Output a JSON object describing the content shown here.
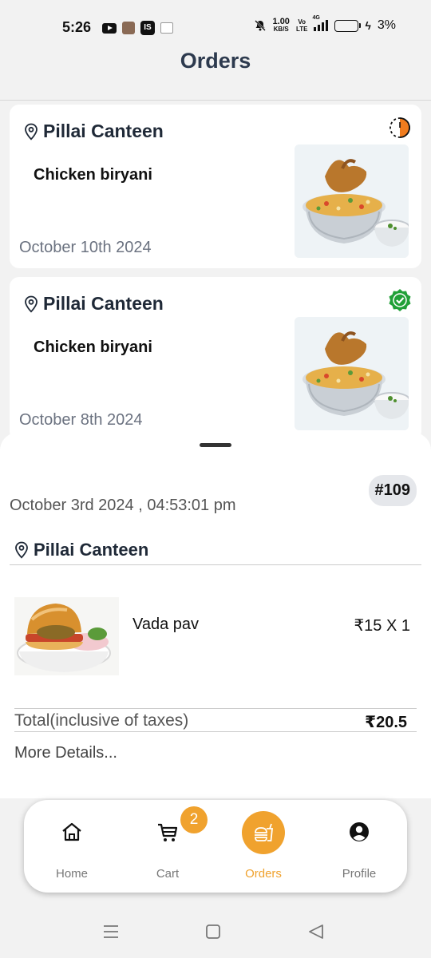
{
  "status_bar": {
    "time": "5:26",
    "is_badge": "IS",
    "net_speed": "1.00",
    "net_unit": "KB/S",
    "volte_top": "Vo",
    "volte_bottom": "LTE",
    "network": "4G",
    "battery_percent": "3%"
  },
  "header": {
    "title": "Orders"
  },
  "orders": [
    {
      "store": "Pillai Canteen",
      "item": "Chicken biryani",
      "date": "October 10th 2024",
      "status_icon": "pending-timer-icon"
    },
    {
      "store": "Pillai Canteen",
      "item": "Chicken biryani",
      "date": "October 8th 2024",
      "status_icon": "completed-check-icon"
    }
  ],
  "detail_sheet": {
    "order_number": "#109",
    "datetime": "October 3rd 2024 , 04:53:01 pm",
    "store": "Pillai Canteen",
    "item_name": "Vada pav",
    "item_price_qty": "₹15 X 1",
    "total_label": "Total(inclusive of taxes)",
    "total_value": "₹20.5",
    "more_details": "More Details..."
  },
  "bottom_nav": {
    "items": [
      {
        "label": "Home",
        "icon": "home-icon"
      },
      {
        "label": "Cart",
        "icon": "cart-icon",
        "badge": "2"
      },
      {
        "label": "Orders",
        "icon": "burger-drink-icon",
        "active": true
      },
      {
        "label": "Profile",
        "icon": "profile-icon"
      }
    ]
  },
  "colors": {
    "accent": "#f0a22e",
    "title": "#2d3a4e",
    "pending": "#f07c1e",
    "success": "#21a038"
  }
}
